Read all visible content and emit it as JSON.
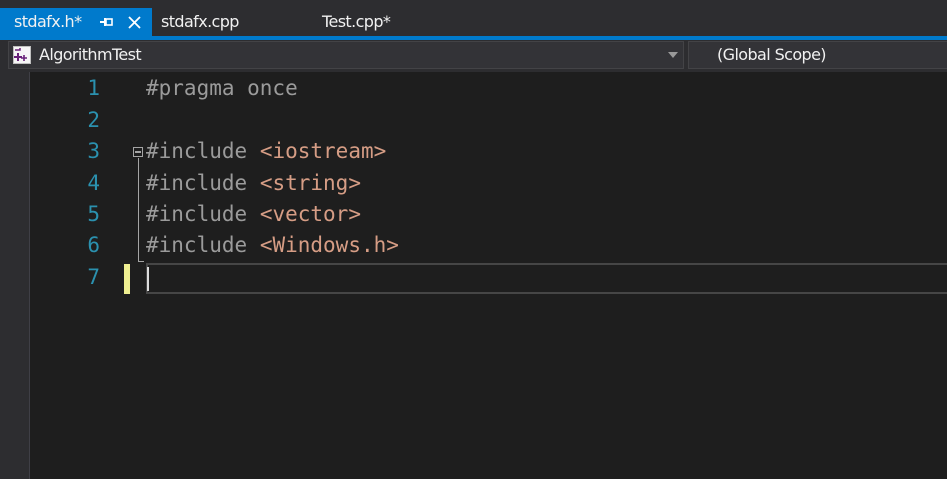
{
  "tabs": [
    {
      "label": "stdafx.h*",
      "active": true,
      "pinned": true
    },
    {
      "label": "stdafx.cpp",
      "active": false
    },
    {
      "label": "Test.cpp*",
      "active": false
    }
  ],
  "navbar": {
    "project": "AlgorithmTest",
    "scope": "(Global Scope)"
  },
  "editor": {
    "line_numbers": [
      "1",
      "2",
      "3",
      "4",
      "5",
      "6",
      "7"
    ],
    "lines": [
      {
        "directive": "#pragma once",
        "header": ""
      },
      {
        "directive": "",
        "header": ""
      },
      {
        "directive": "#include",
        "header": "<iostream>"
      },
      {
        "directive": "#include",
        "header": "<string>"
      },
      {
        "directive": "#include",
        "header": "<vector>"
      },
      {
        "directive": "#include",
        "header": "<Windows.h>"
      },
      {
        "directive": "",
        "header": ""
      }
    ],
    "current_line": "7"
  },
  "colors": {
    "accent": "#007acc",
    "background": "#1e1e1e",
    "line_number": "#2b91af",
    "preprocessor": "#9b9b9b",
    "string": "#d69d85",
    "change_marker": "#efef91"
  },
  "icons": [
    "pin-icon",
    "close-icon",
    "project-icon",
    "chevron-down-icon",
    "outline-collapse-icon"
  ]
}
